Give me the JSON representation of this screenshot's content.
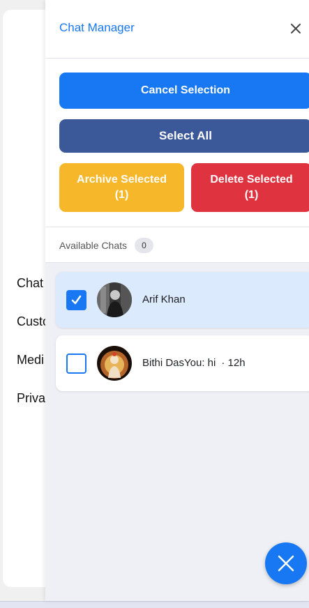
{
  "background": {
    "menu_items": [
      "Chat",
      "Custo",
      "Medi",
      "Priva"
    ]
  },
  "panel": {
    "title": "Chat Manager",
    "close_icon": "close-icon"
  },
  "actions": {
    "cancel_label": "Cancel Selection",
    "select_all_label": "Select All",
    "archive_label": "Archive Selected",
    "archive_count": "(1)",
    "delete_label": "Delete Selected",
    "delete_count": "(1)"
  },
  "available": {
    "label": "Available Chats",
    "count": "0"
  },
  "chats": [
    {
      "name": "Arif Khan",
      "meta": "",
      "selected": true
    },
    {
      "name": "Bithi DasYou: hi",
      "meta": "· 12h",
      "selected": false
    }
  ],
  "colors": {
    "accent": "#1877f2",
    "select_all": "#3b5998",
    "archive": "#f6b82a",
    "delete": "#e03340",
    "selected_row": "#dbeafc"
  },
  "fab_icon": "close-icon"
}
